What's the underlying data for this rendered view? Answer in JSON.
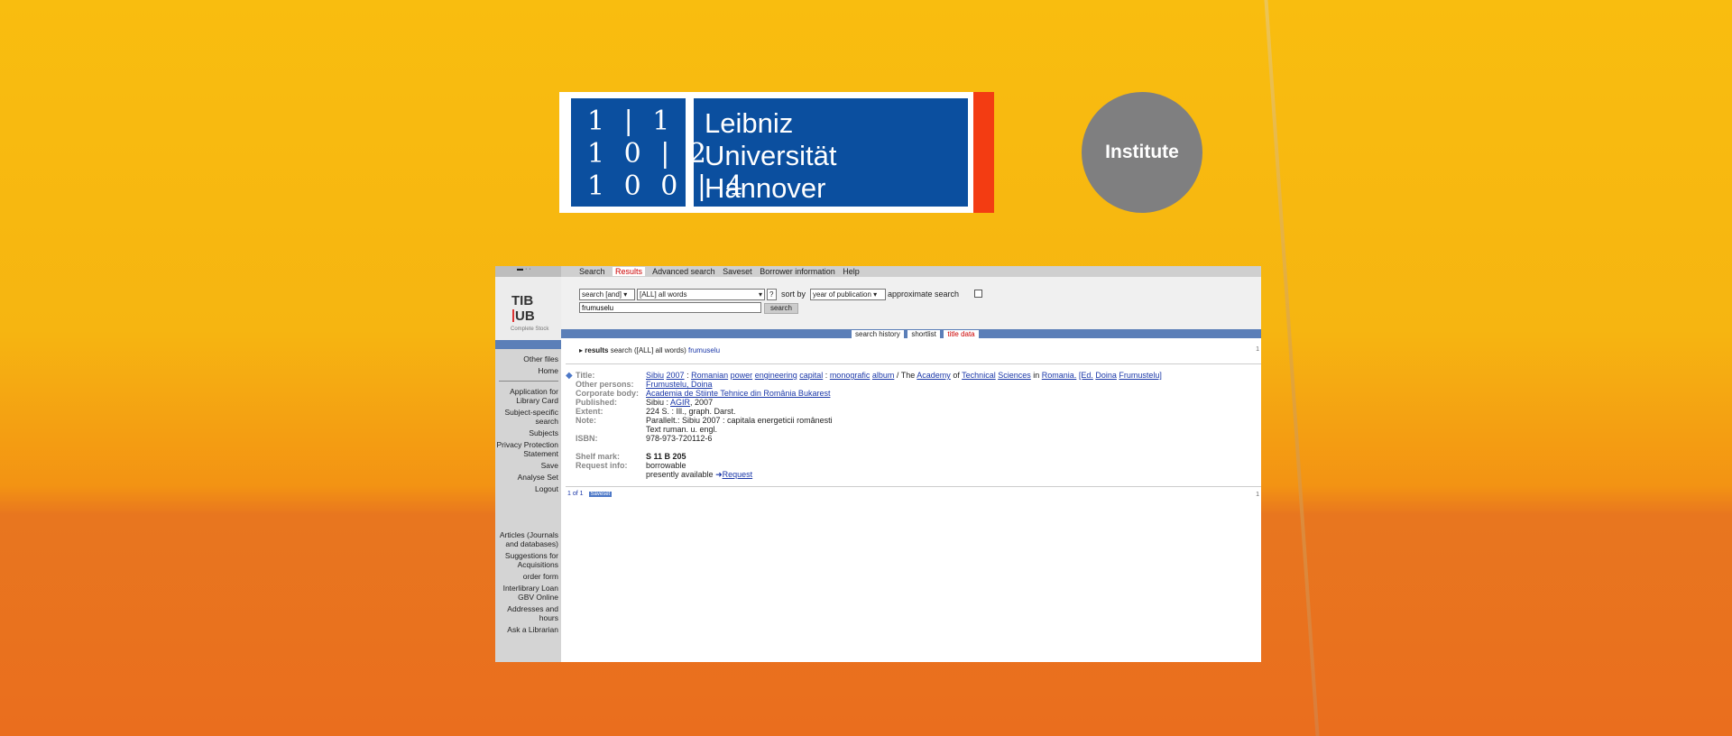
{
  "logo": {
    "glyph_rows": [
      "1 | 1",
      "1 0 | 2",
      "1 0 0 | 4"
    ],
    "name_lines": [
      "Leibniz",
      "Universität",
      "Hannover"
    ]
  },
  "institute_label": "Institute",
  "lang_bar": "▬ · ·",
  "tib": {
    "line1": "TIB",
    "line2": "UB",
    "stock": "Complete Stock"
  },
  "menu": [
    "Search",
    "Results",
    "Advanced search",
    "Saveset",
    "Borrower information",
    "Help"
  ],
  "search": {
    "operator": "search [and]",
    "field": "[ALL] all words",
    "help": "?",
    "sort_label": "sort by",
    "sort_value": "year of publication",
    "approx_label": "approximate search",
    "query": "frumuselu",
    "button": "search"
  },
  "tabs": [
    "search history",
    "shortlist",
    "title data"
  ],
  "sidebar": {
    "group1": [
      "Other files",
      "Home"
    ],
    "group2": [
      "Application for Library Card",
      "Subject-specific search",
      "Subjects",
      "Privacy Protection Statement",
      "Save",
      "Analyse Set",
      "Logout"
    ],
    "group3": [
      "Articles (Journals and databases)",
      "Suggestions for Acquisitions",
      "order form",
      "Interlibrary Loan GBV Online",
      "Addresses and hours",
      "Ask a Librarian"
    ]
  },
  "results_head": {
    "bold": "results",
    "text": " search ([ALL] all words) ",
    "term": "frumuselu",
    "page": "1"
  },
  "record": {
    "labels": [
      "Title:",
      "Other persons:",
      "Corporate body:",
      "Published:",
      "Extent:",
      "Note:",
      "ISBN:",
      "Shelf mark:",
      "Request info:"
    ],
    "title_parts": [
      "Sibiu",
      "2007",
      ":",
      "Romanian",
      "power",
      "engineering",
      "capital",
      ":",
      "monografic",
      "album",
      "/ The",
      "Academy",
      "of",
      "Technical",
      "Sciences",
      "in",
      "Romania.",
      "[Ed.",
      "Doina",
      "Frumustelu]"
    ],
    "other_persons": "Frumustelu, Doina",
    "corporate_body": "Academia de Stiinte Tehnice din România Bukarest",
    "published_pre": "Sibiu : ",
    "published_link": "AGIR",
    "published_post": ", 2007",
    "extent": "224 S. : Ill., graph. Darst.",
    "note1": "Parallelt.: Sibiu 2007 : capitala energeticii românesti",
    "note2": "Text ruman. u. engl.",
    "isbn": "978-973-720112-6",
    "shelf_mark": "S 11 B 205",
    "request_info": "borrowable",
    "availability": "presently available",
    "request_link": "Request"
  },
  "footer": {
    "count": "1 of 1",
    "chip": "Saveset",
    "page": "1"
  }
}
